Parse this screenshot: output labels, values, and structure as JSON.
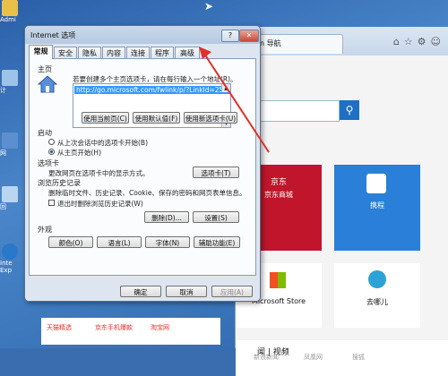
{
  "desktop": {
    "icons": [
      {
        "label": "Admi"
      },
      {
        "label": "计"
      },
      {
        "label": "网"
      },
      {
        "label": "回"
      },
      {
        "label": "Inte Exp"
      }
    ]
  },
  "browser": {
    "tab_title": "n 导航",
    "tiles": {
      "jd": "京东商城",
      "jd_logo": "京东",
      "ctrip": "携程",
      "microsoft": "Microsoft Store",
      "qunar": "去哪儿"
    },
    "news_header": "闻 | 视频",
    "bottom_left": [
      "天猫精选",
      "京东手机爆款",
      "淘宝网"
    ],
    "bottom_right": [
      "新浪新闻",
      "凤凰网",
      "搜狐"
    ]
  },
  "dialog": {
    "title": "Internet 选项",
    "help": "?",
    "close": "✕",
    "tabs": [
      "常规",
      "安全",
      "隐私",
      "内容",
      "连接",
      "程序",
      "高级"
    ],
    "active_tab": "常规",
    "homepage": {
      "label": "主页",
      "instruction": "若要创建多个主页选项卡，请在每行输入一个地址(R)。",
      "url": "http://go.microsoft.com/fwlink/p/?LinkId=255",
      "btn_current": "使用当前页(C)",
      "btn_default": "使用默认值(F)",
      "btn_new_tab": "使用新选项卡(U)"
    },
    "startup": {
      "label": "启动",
      "option1": "从上次会话中的选项卡开始(B)",
      "option2": "从主页开始(H)",
      "selected": "从主页开始(H)"
    },
    "tabs_section": {
      "label": "选项卡",
      "text": "更改网页在选项卡中的显示方式。",
      "button": "选项卡(T)"
    },
    "history": {
      "label": "浏览历史记录",
      "text": "删除临时文件、历史记录、Cookie、保存的密码和网页表单信息。",
      "checkbox": "退出时删除浏览历史记录(W)",
      "btn_delete": "删除(D)...",
      "btn_settings": "设置(S)"
    },
    "appearance": {
      "label": "外观",
      "btn_colors": "颜色(O)",
      "btn_languages": "语言(L)",
      "btn_fonts": "字体(N)",
      "btn_accessibility": "辅助功能(E)"
    },
    "footer": {
      "ok": "确定",
      "cancel": "取消",
      "apply": "应用(A)"
    }
  },
  "colors": {
    "annotation_arrow": "#e0302a",
    "jd_red": "#c0152a",
    "ctrip_blue": "#2a7fd8"
  }
}
